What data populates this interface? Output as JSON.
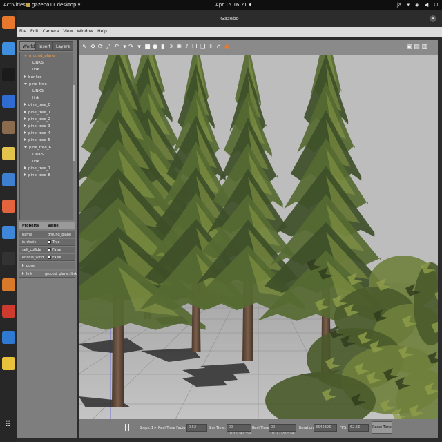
{
  "topbar": {
    "activities": "Activities",
    "app_name": "gazebo11.desktop ▾",
    "clock": "Apr 15  16:21",
    "user": "ja"
  },
  "dock": {
    "apps": [
      {
        "name": "firefox",
        "color": "#e8772e"
      },
      {
        "name": "chrome",
        "color": "#3f8fe0"
      },
      {
        "name": "pycharm",
        "color": "#1b1b1b"
      },
      {
        "name": "thunderbird",
        "color": "#2f6bd0"
      },
      {
        "name": "files",
        "color": "#8a6b4e"
      },
      {
        "name": "rhythmbox",
        "color": "#e2c34c"
      },
      {
        "name": "writer",
        "color": "#3e7fd0"
      },
      {
        "name": "software",
        "color": "#e3643c"
      },
      {
        "name": "help",
        "color": "#3e86d8"
      },
      {
        "name": "terminal",
        "color": "#333333"
      },
      {
        "name": "gazebo",
        "color": "#d97a2a"
      },
      {
        "name": "screenshot",
        "color": "#cc3b2e"
      },
      {
        "name": "vscode",
        "color": "#2f7ad0"
      },
      {
        "name": "notes",
        "color": "#e8c23a"
      },
      {
        "name": "show-apps",
        "color": "#444444"
      }
    ]
  },
  "window": {
    "title": "Gazebo"
  },
  "menu": [
    "File",
    "Edit",
    "Camera",
    "View",
    "Window",
    "Help"
  ],
  "left_panel": {
    "tabs": [
      "World",
      "Insert",
      "Layers"
    ],
    "tree": [
      {
        "label": "ground_plane",
        "indent": 0,
        "arrow": "down-orange",
        "highlight": true
      },
      {
        "label": "LINKS",
        "indent": 2,
        "arrow": "none"
      },
      {
        "label": "link",
        "indent": 2,
        "arrow": "none"
      },
      {
        "label": "bunker",
        "indent": 0,
        "arrow": "right"
      },
      {
        "label": "pine_tree",
        "indent": 0,
        "arrow": "down"
      },
      {
        "label": "LINKS",
        "indent": 2,
        "arrow": "none"
      },
      {
        "label": "link",
        "indent": 2,
        "arrow": "none"
      },
      {
        "label": "pine_tree_0",
        "indent": 0,
        "arrow": "right"
      },
      {
        "label": "pine_tree_1",
        "indent": 0,
        "arrow": "right"
      },
      {
        "label": "pine_tree_2",
        "indent": 0,
        "arrow": "right"
      },
      {
        "label": "pine_tree_3",
        "indent": 0,
        "arrow": "right"
      },
      {
        "label": "pine_tree_4",
        "indent": 0,
        "arrow": "right"
      },
      {
        "label": "pine_tree_5",
        "indent": 0,
        "arrow": "right"
      },
      {
        "label": "pine_tree_6",
        "indent": 0,
        "arrow": "down"
      },
      {
        "label": "LINKS",
        "indent": 2,
        "arrow": "none"
      },
      {
        "label": "link",
        "indent": 2,
        "arrow": "none"
      },
      {
        "label": "pine_tree_7",
        "indent": 0,
        "arrow": "right"
      },
      {
        "label": "pine_tree_8",
        "indent": 0,
        "arrow": "right"
      }
    ],
    "props_header": {
      "property": "Property",
      "value": "Value"
    },
    "props": [
      {
        "name": "name",
        "value": "ground_plane",
        "check": false
      },
      {
        "name": "is_static",
        "value": "True",
        "check": true
      },
      {
        "name": "self_collide",
        "value": "False",
        "check": true
      },
      {
        "name": "enable_wind",
        "value": "False",
        "check": true
      },
      {
        "name": "pose",
        "value": "",
        "check": false,
        "expand": true
      },
      {
        "name": "link",
        "value": "ground_plane::link",
        "check": false,
        "expand": true
      }
    ]
  },
  "toolbar": {
    "tools": [
      "select",
      "translate",
      "rotate",
      "scale",
      "undo",
      "undo-dropdown",
      "redo",
      "redo-dropdown",
      "box",
      "sphere",
      "cylinder",
      "sun-light",
      "spot-light",
      "directional-light",
      "copy",
      "paste",
      "align",
      "snap",
      "record"
    ]
  },
  "status": {
    "steps_label": "Steps:",
    "steps_value": "1 ▸",
    "rtf_label": "Real Time Factor:",
    "rtf_value": "0.52",
    "sim_time_label": "Sim Time:",
    "sim_time_value": "00 01:00:42.396",
    "real_time_label": "Real Time:",
    "real_time_value": "00 01:17:20.514",
    "iterations_label": "Iterations:",
    "iterations_value": "3642396",
    "fps_label": "FPS:",
    "fps_value": "62.56",
    "reset_label": "Reset Time"
  },
  "colors": {
    "sky": "#bdbdbd",
    "ground": "#a9a9a9",
    "foliage_dark": "#3e4f28",
    "foliage_light": "#8a9b45",
    "trunk": "#6b5140",
    "highlight": "#f0a040"
  }
}
